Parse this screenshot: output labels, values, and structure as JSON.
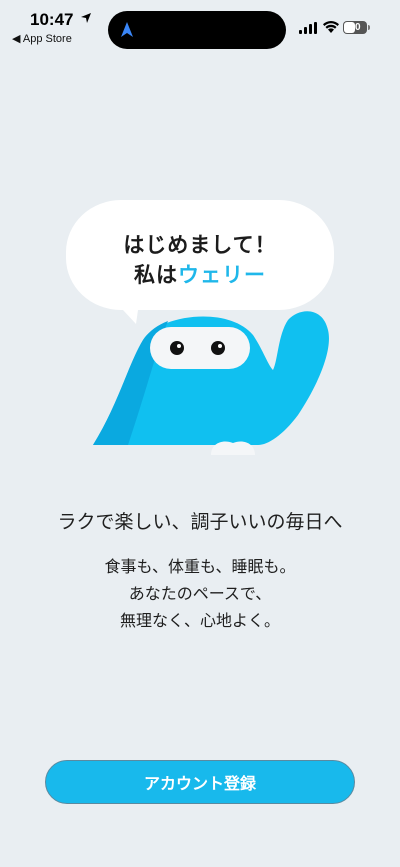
{
  "status_bar": {
    "time": "10:47",
    "back_label": "◀ App Store",
    "battery": "40"
  },
  "bubble": {
    "line1": "はじめまして！",
    "line2_prefix": "私は",
    "line2_name": "ウェリー"
  },
  "content": {
    "tagline": "ラクで楽しい、調子いいの毎日へ",
    "desc_line1": "食事も、体重も、睡眠も。",
    "desc_line2": "あなたのペースで、",
    "desc_line3": "無理なく、心地よく。"
  },
  "buttons": {
    "register": "アカウント登録"
  },
  "colors": {
    "background": "#e9eef2",
    "accent": "#1fb7ea",
    "mascot": "#10c0f0",
    "button": "#18b9ec"
  }
}
